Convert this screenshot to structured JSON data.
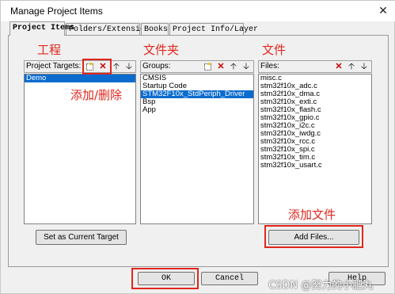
{
  "window": {
    "title": "Manage Project Items",
    "close_glyph": "✕"
  },
  "tabs": [
    {
      "label": "Project Items",
      "active": true
    },
    {
      "label": "Folders/Extensions",
      "active": false
    },
    {
      "label": "Books",
      "active": false
    },
    {
      "label": "Project Info/Layer",
      "active": false
    }
  ],
  "targets": {
    "header": "Project Targets:",
    "items": [
      "Demo"
    ],
    "selected_index": 0,
    "button": "Set as Current Target"
  },
  "groups": {
    "header": "Groups:",
    "items": [
      "CMSIS",
      "Startup Code",
      "STM32F10x_StdPeriph_Driver",
      "Bsp",
      "App"
    ],
    "selected_index": 2
  },
  "files": {
    "header": "Files:",
    "items": [
      "misc.c",
      "stm32f10x_adc.c",
      "stm32f10x_dma.c",
      "stm32f10x_exti.c",
      "stm32f10x_flash.c",
      "stm32f10x_gpio.c",
      "stm32f10x_i2c.c",
      "stm32f10x_iwdg.c",
      "stm32f10x_rcc.c",
      "stm32f10x_spi.c",
      "stm32f10x_tim.c",
      "stm32f10x_usart.c"
    ],
    "button": "Add Files..."
  },
  "toolbar_icons": [
    "new-item-icon",
    "delete-icon",
    "move-up-icon",
    "move-down-icon"
  ],
  "footer": {
    "ok": "OK",
    "cancel": "Cancel",
    "help": "Help"
  },
  "annotations": {
    "project": "工程",
    "folder": "文件夹",
    "file": "文件",
    "add_delete": "添加/删除",
    "add_file": "添加文件",
    "color": "#e1261c"
  },
  "watermark": "CSDN @努力的小肥丸",
  "selection_color": "#0a6cce"
}
